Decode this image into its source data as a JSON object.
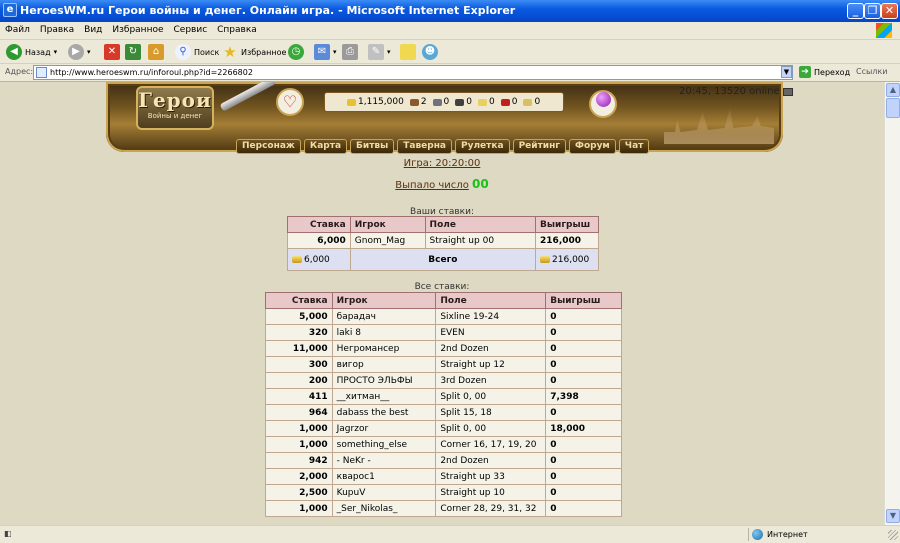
{
  "window": {
    "title": "HeroesWM.ru Герои войны и денег. Онлайн игра. - Microsoft Internet Explorer"
  },
  "menu": [
    "Файл",
    "Правка",
    "Вид",
    "Избранное",
    "Сервис",
    "Справка"
  ],
  "toolbar": {
    "back": "Назад",
    "search": "Поиск",
    "favorites": "Избранное"
  },
  "address": {
    "label": "Адрес:",
    "url": "http://www.heroeswm.ru/inforoul.php?id=2266802",
    "go": "Переход",
    "links": "Ссылки"
  },
  "status": {
    "zone": "Интернет"
  },
  "header": {
    "logo": "Герои",
    "logo_sub": "Войны и денег",
    "online": "20:45, 13520 online",
    "resources": [
      {
        "value": "1,115,000",
        "color": "#e8c030"
      },
      {
        "value": "2",
        "color": "#8a5a2a"
      },
      {
        "value": "0",
        "color": "#707080"
      },
      {
        "value": "0",
        "color": "#404040"
      },
      {
        "value": "0",
        "color": "#e8d060"
      },
      {
        "value": "0",
        "color": "#c02020"
      },
      {
        "value": "0",
        "color": "#d8c060"
      }
    ],
    "nav": [
      "Персонаж",
      "Карта",
      "Битвы",
      "Таверна",
      "Рулетка",
      "Рейтинг",
      "Форум",
      "Чат"
    ]
  },
  "game": {
    "label": "Игра: 20:20:00",
    "result_label": "Выпало число",
    "result_number": "00"
  },
  "my_bets": {
    "caption": "Ваши ставки:",
    "columns": [
      "Ставка",
      "Игрок",
      "Поле",
      "Выигрыш"
    ],
    "rows": [
      {
        "stake": "6,000",
        "player": "Gnom_Mag",
        "field": "Straight up 00",
        "win": "216,000"
      }
    ],
    "total": {
      "stake": "6,000",
      "label": "Всего",
      "win": "216,000"
    }
  },
  "all_bets": {
    "caption": "Все ставки:",
    "columns": [
      "Ставка",
      "Игрок",
      "Поле",
      "Выигрыш"
    ],
    "rows": [
      {
        "stake": "5,000",
        "player": "барадач",
        "field": "Sixline 19-24",
        "win": "0"
      },
      {
        "stake": "320",
        "player": "laki 8",
        "field": "EVEN",
        "win": "0"
      },
      {
        "stake": "11,000",
        "player": "Негромансер",
        "field": "2nd Dozen",
        "win": "0"
      },
      {
        "stake": "300",
        "player": "вигор",
        "field": "Straight up 12",
        "win": "0"
      },
      {
        "stake": "200",
        "player": "ПРОСТО ЭЛЬФЫ",
        "field": "3rd Dozen",
        "win": "0"
      },
      {
        "stake": "411",
        "player": "__хитман__",
        "field": "Split 0, 00",
        "win": "7,398"
      },
      {
        "stake": "964",
        "player": "dabass the best",
        "field": "Split 15, 18",
        "win": "0"
      },
      {
        "stake": "1,000",
        "player": "Jagrzor",
        "field": "Split 0, 00",
        "win": "18,000"
      },
      {
        "stake": "1,000",
        "player": "something_else",
        "field": "Corner 16, 17, 19, 20",
        "win": "0"
      },
      {
        "stake": "942",
        "player": "- NeKr -",
        "field": "2nd Dozen",
        "win": "0"
      },
      {
        "stake": "2,000",
        "player": "кварос1",
        "field": "Straight up 33",
        "win": "0"
      },
      {
        "stake": "2,500",
        "player": "KupuV",
        "field": "Straight up 10",
        "win": "0"
      },
      {
        "stake": "1,000",
        "player": "_Ser_Nikolas_",
        "field": "Corner 28, 29, 31, 32",
        "win": "0"
      }
    ]
  }
}
